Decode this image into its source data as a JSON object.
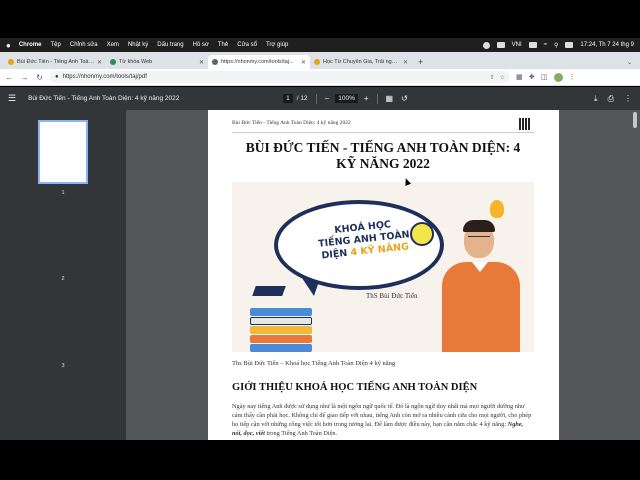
{
  "menubar": {
    "app": "Chrome",
    "items": [
      "Tệp",
      "Chỉnh sửa",
      "Xem",
      "Nhật ký",
      "Dấu trang",
      "Hồ sơ",
      "Thẻ",
      "Cửa sổ",
      "Trợ giúp"
    ],
    "input_source": "VNI",
    "clock": "17:24, Th 7 24 thg 9"
  },
  "tabs": [
    {
      "label": "Bùi Đức Tiến - Tiếng Anh Toàn...",
      "favicon_color": "#e8a317",
      "active": false
    },
    {
      "label": "Từ khóa Web",
      "favicon_color": "#2e8b57",
      "active": false
    },
    {
      "label": "https://nhonmy.com/tools/taj...",
      "favicon_color": "#5f6368",
      "active": true
    },
    {
      "label": "Học Từ Chuyên Gia, Trải nghiệm...",
      "favicon_color": "#e8a317",
      "active": false
    }
  ],
  "omnibox": {
    "url": "https://nhonmy.com/tools/taj/pdf"
  },
  "pdf_toolbar": {
    "title": "Bùi Đức Tiến - Tiếng Anh Toàn Diện: 4 kỹ năng 2022",
    "current_page": "1",
    "total_pages": "/ 12",
    "zoom": "100%"
  },
  "thumbnails": [
    "1",
    "2",
    "3"
  ],
  "page": {
    "header": "Bùi Đức Tiến - Tiếng Anh Toàn Diện: 4 kỹ năng 2022",
    "title_line1": "BÙI ĐỨC TIẾN - TIẾNG ANH TOÀN DIỆN: 4",
    "title_line2": "KỸ NĂNG 2022",
    "banner": {
      "line1": "KHOÁ HỌC",
      "line2": "TIẾNG ANH TOÀN",
      "line3a": "DIỆN",
      "line3b": "4 KỸ NĂNG",
      "teacher": "ThS Bùi Đức Tiến"
    },
    "caption": "Ths Bùi Đức Tiến – Khoá học Tiếng Anh Toàn Diện 4 kỹ năng",
    "section_title": "GIỚI THIỆU KHOÁ HỌC TIẾNG ANH TOÀN DIỆN",
    "paragraph_before": "Ngày nay tiếng Anh được sử dụng như là một ngôn ngữ quốc tế. Đó là ngôn ngữ duy nhất mà mọi người dường như cảm thấy cần phải học. Không chỉ để giao tiếp với nhau, tiếng Anh còn mở ra nhiều cánh cửa cho mọi người, cho phép họ tiếp cận với những công việc tốt hơn trong tương lai. Để làm được điều này, bạn cần nắm chắc 4 kỹ năng: ",
    "paragraph_emph": "Nghe, nói, đọc, viết",
    "paragraph_after": " trong Tiếng Anh Toàn Diện."
  }
}
